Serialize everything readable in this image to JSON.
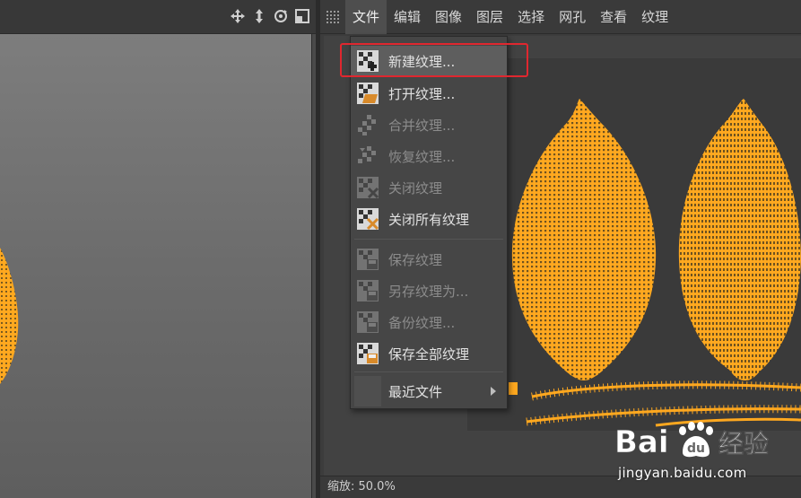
{
  "menubar": {
    "items": [
      "文件",
      "编辑",
      "图像",
      "图层",
      "选择",
      "网孔",
      "查看",
      "纹理"
    ],
    "active_index": 0
  },
  "file_menu": {
    "items": [
      {
        "label": "新建纹理...",
        "enabled": true,
        "icon": "new-texture-icon"
      },
      {
        "label": "打开纹理...",
        "enabled": true,
        "icon": "open-texture-icon"
      },
      {
        "label": "合并纹理...",
        "enabled": false,
        "icon": "merge-texture-icon"
      },
      {
        "label": "恢复纹理...",
        "enabled": false,
        "icon": "revert-texture-icon"
      },
      {
        "label": "关闭纹理",
        "enabled": false,
        "icon": "close-texture-icon"
      },
      {
        "label": "关闭所有纹理",
        "enabled": true,
        "icon": "close-all-textures-icon"
      },
      {
        "label": "保存纹理",
        "enabled": false,
        "icon": "save-texture-icon"
      },
      {
        "label": "另存纹理为...",
        "enabled": false,
        "icon": "save-texture-as-icon"
      },
      {
        "label": "备份纹理...",
        "enabled": false,
        "icon": "backup-texture-icon"
      },
      {
        "label": "保存全部纹理",
        "enabled": true,
        "icon": "save-all-textures-icon"
      },
      {
        "label": "最近文件",
        "enabled": true,
        "icon": "submenu-arrow-icon"
      }
    ]
  },
  "statusbar": {
    "zoom": "缩放: 50.0%"
  },
  "watermark": {
    "brand": "Bai du 经验",
    "url": "jingyan.baidu.com"
  },
  "colors": {
    "mesh": "#ffa81f",
    "highlight_box": "#e0272f",
    "menu_bg": "#464646"
  }
}
